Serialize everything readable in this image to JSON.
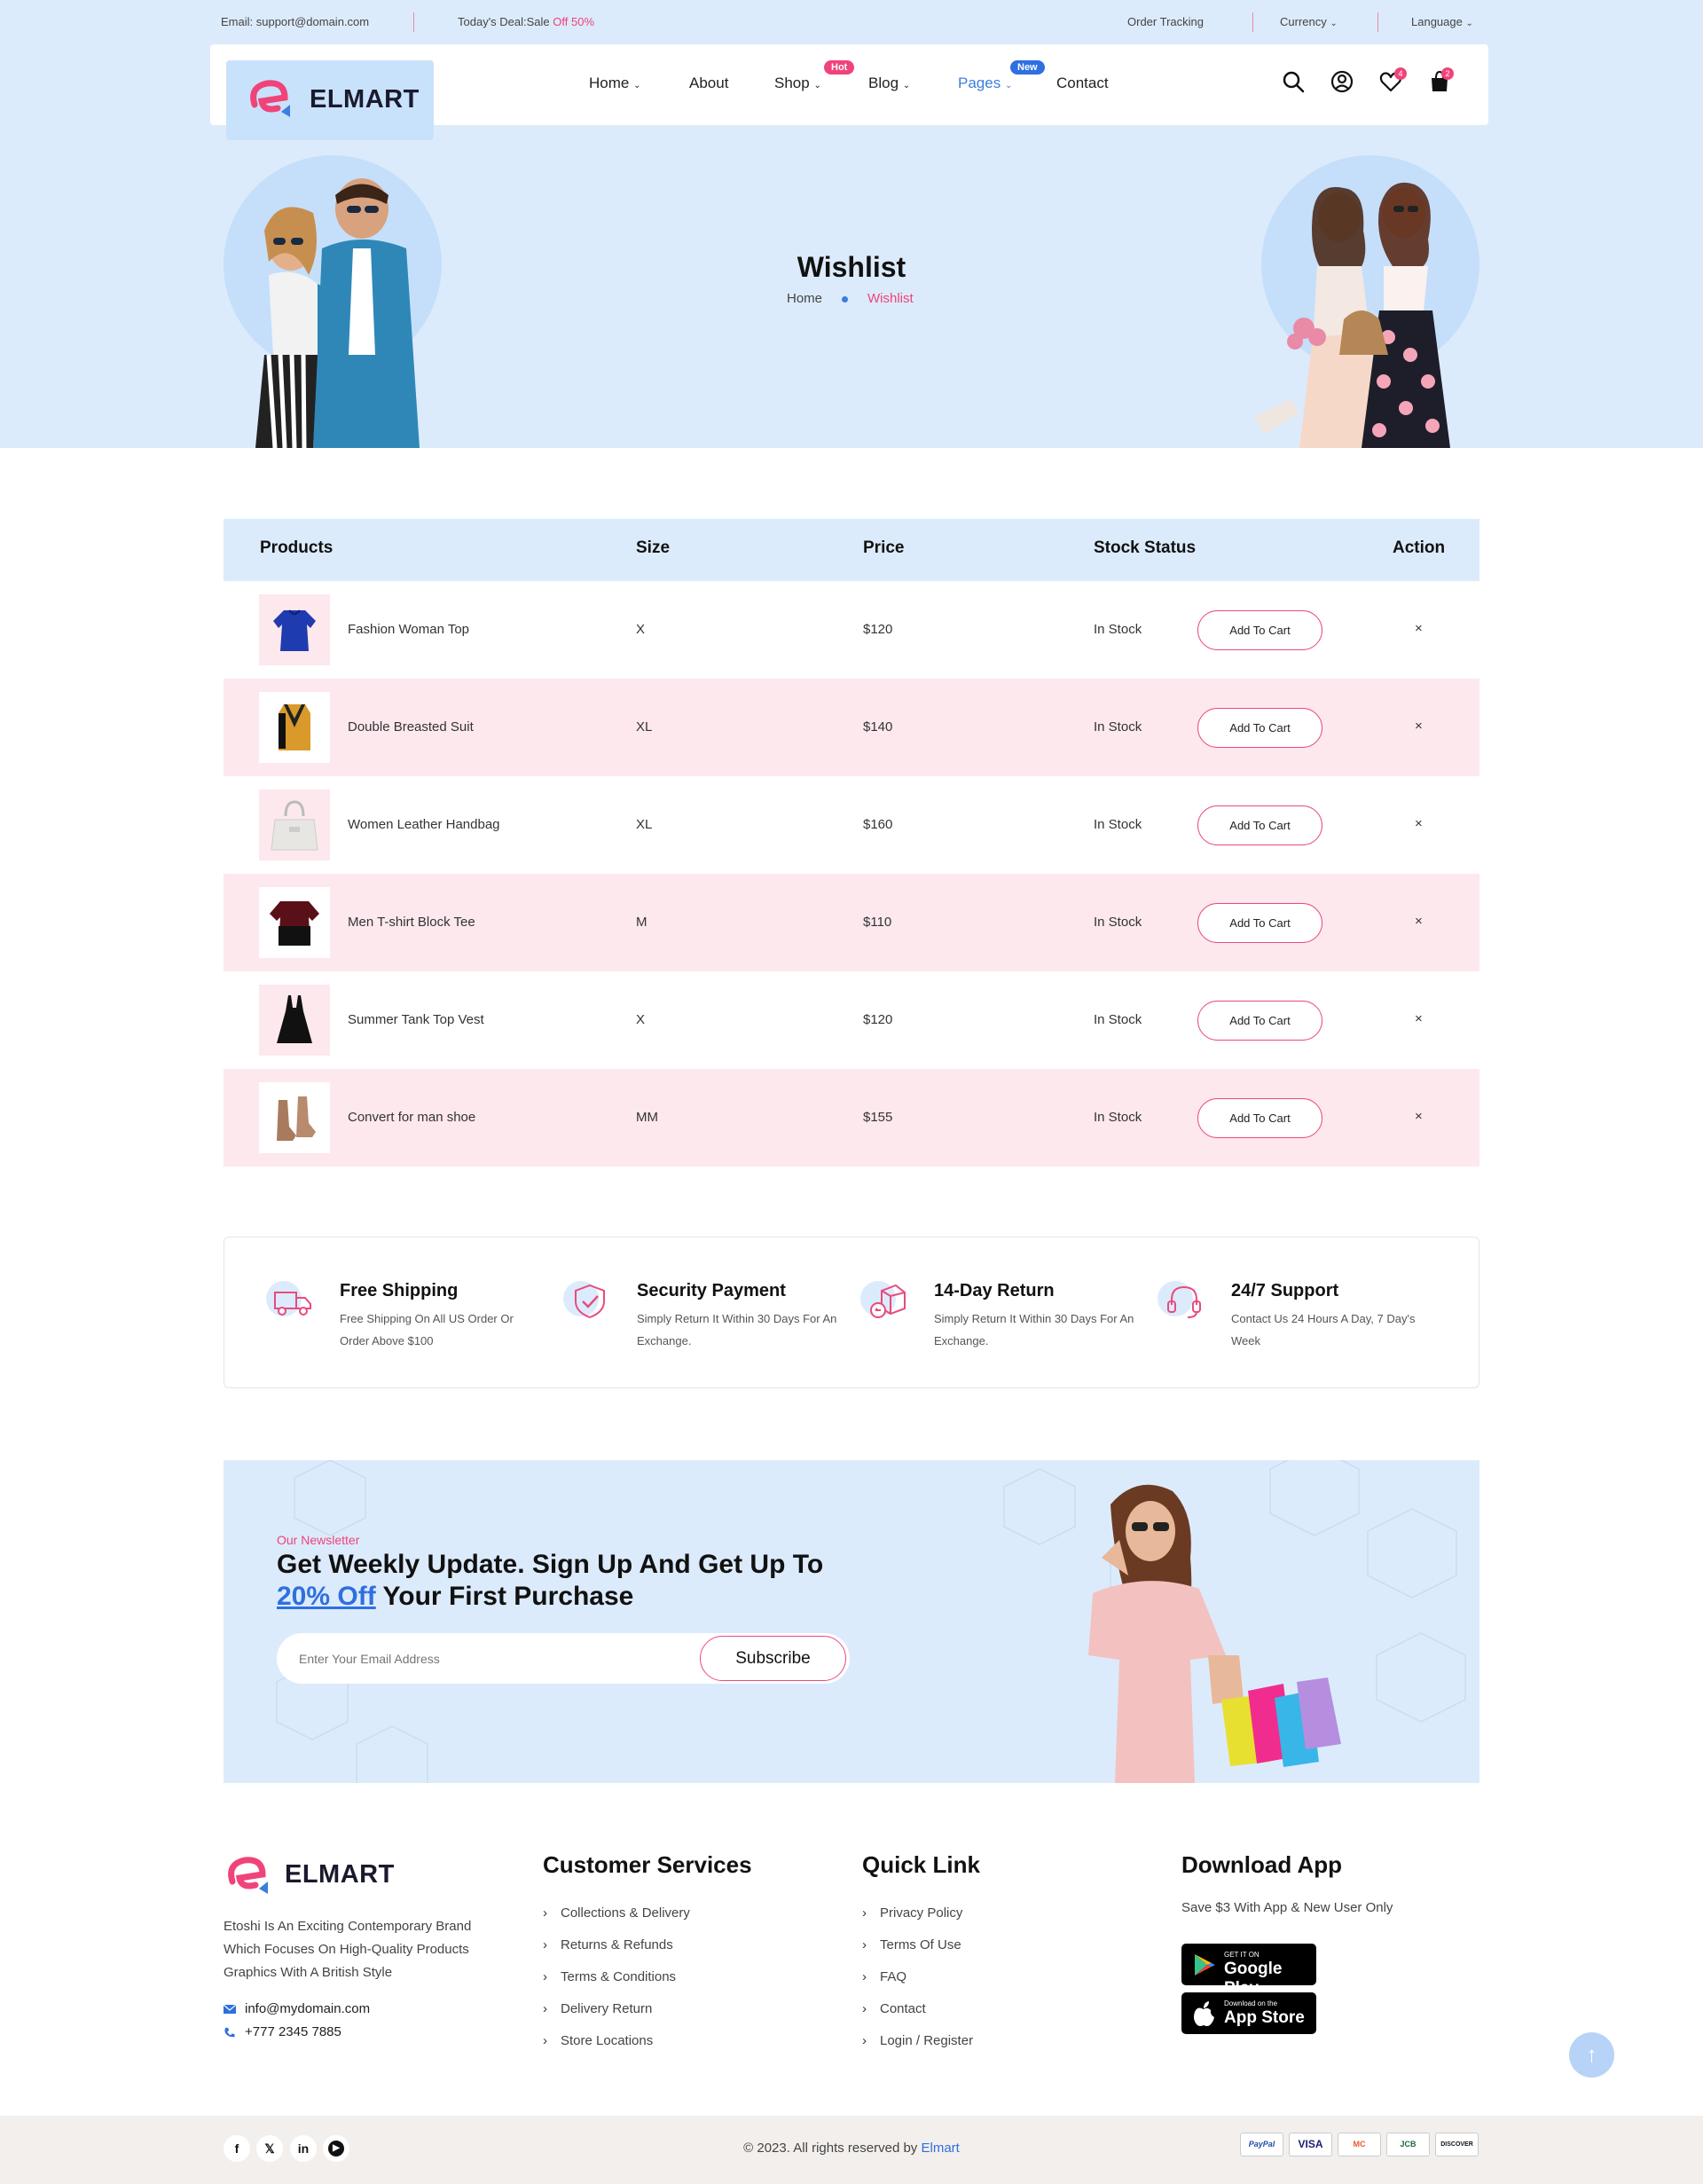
{
  "topbar": {
    "email": "Email: support@domain.com",
    "deal_prefix": "Today's Deal:Sale",
    "deal_highlight": "Off 50%",
    "order_tracking": "Order Tracking",
    "currency": "Currency",
    "language": "Language"
  },
  "brand": {
    "name": "ELMART",
    "accent": "#f0437a",
    "primary": "#2f6fe0"
  },
  "nav": {
    "items": [
      {
        "label": "Home",
        "has_dropdown": true
      },
      {
        "label": "About",
        "has_dropdown": false
      },
      {
        "label": "Shop",
        "has_dropdown": true,
        "badge": "Hot"
      },
      {
        "label": "Blog",
        "has_dropdown": true
      },
      {
        "label": "Pages",
        "has_dropdown": true,
        "badge": "New",
        "active": true
      },
      {
        "label": "Contact",
        "has_dropdown": false
      }
    ],
    "wishlist_count": "4",
    "cart_count": "2",
    "icons": [
      "search-icon",
      "user-icon",
      "heart-icon",
      "bag-icon"
    ]
  },
  "hero": {
    "title": "Wishlist",
    "breadcrumb_home": "Home",
    "breadcrumb_current": "Wishlist"
  },
  "table": {
    "headers": [
      "Products",
      "Size",
      "Price",
      "Stock Status",
      "Action"
    ],
    "rows": [
      {
        "product": "Fashion Woman Top",
        "size": "X",
        "price": "$120",
        "stock": "In Stock",
        "action": "Add To Cart",
        "remove": "×"
      },
      {
        "product": "Double Breasted Suit",
        "size": "XL",
        "price": "$140",
        "stock": "In Stock",
        "action": "Add To Cart",
        "remove": "×"
      },
      {
        "product": "Women Leather Handbag",
        "size": "XL",
        "price": "$160",
        "stock": "In Stock",
        "action": "Add To Cart",
        "remove": "×"
      },
      {
        "product": "Men T-shirt Block Tee",
        "size": "M",
        "price": "$110",
        "stock": "In Stock",
        "action": "Add To Cart",
        "remove": "×"
      },
      {
        "product": "Summer Tank Top Vest",
        "size": "X",
        "price": "$120",
        "stock": "In Stock",
        "action": "Add To Cart",
        "remove": "×"
      },
      {
        "product": "Convert for man shoe",
        "size": "MM",
        "price": "$155",
        "stock": "In Stock",
        "action": "Add To Cart",
        "remove": "×"
      }
    ]
  },
  "features": [
    {
      "title": "Free Shipping",
      "desc": "Free Shipping On All US Order Or Order Above $100",
      "icon": "truck-icon"
    },
    {
      "title": "Security Payment",
      "desc": "Simply Return It Within 30 Days For An Exchange.",
      "icon": "shield-check-icon"
    },
    {
      "title": "14-Day Return",
      "desc": "Simply Return It Within 30 Days For An Exchange.",
      "icon": "return-box-icon"
    },
    {
      "title": "24/7 Support",
      "desc": "Contact Us 24 Hours A Day, 7 Day's Week",
      "icon": "headset-icon"
    }
  ],
  "newsletter": {
    "eyebrow": "Our Newsletter",
    "title_line1": "Get Weekly Update. Sign Up And Get Up To",
    "title_highlight": "20% Off",
    "title_rest": "Your First Purchase",
    "placeholder": "Enter Your Email Address",
    "button": "Subscribe"
  },
  "footer": {
    "about": "Etoshi Is An Exciting Contemporary Brand Which Focuses On High-Quality Products Graphics With A British Style",
    "email": "info@mydomain.com",
    "phone": "+777 2345 7885",
    "customer_services": {
      "title": "Customer Services",
      "links": [
        "Collections & Delivery",
        "Returns & Refunds",
        "Terms & Conditions",
        "Delivery Return",
        "Store Locations"
      ]
    },
    "quick_link": {
      "title": "Quick Link",
      "links": [
        "Privacy Policy",
        "Terms Of Use",
        "FAQ",
        "Contact",
        "Login / Register"
      ]
    },
    "download": {
      "title": "Download App",
      "subtitle": "Save $3 With App & New User Only",
      "google_small": "GET IT ON",
      "google_large": "Google Play",
      "apple_small": "Download on the",
      "apple_large": "App Store"
    },
    "copyright_prefix": "© 2023. All rights reserved by",
    "copyright_brand": "Elmart",
    "socials": [
      "f",
      "𝕏",
      "in",
      "▶"
    ],
    "payments": [
      "PayPal",
      "VISA",
      "MC",
      "JCB",
      "DISCOVER"
    ]
  }
}
